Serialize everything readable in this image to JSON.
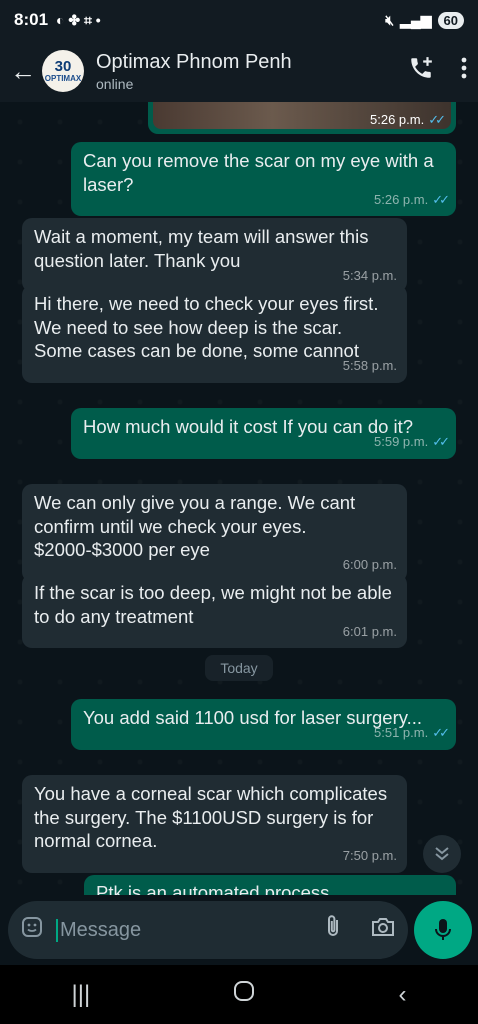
{
  "status_bar": {
    "time": "8:01",
    "battery": "60"
  },
  "header": {
    "chat_name": "Optimax Phnom Penh",
    "chat_status": "online"
  },
  "image_message": {
    "time": "5:26 p.m."
  },
  "messages": [
    {
      "direction": "out",
      "text": "Can you remove the scar on my eye with a laser?",
      "time": "5:26 p.m."
    },
    {
      "direction": "in",
      "text": "Wait a moment, my team will answer this question later. Thank you",
      "time": "5:34 p.m."
    },
    {
      "direction": "in",
      "text": "Hi there, we need to check your eyes first. We need to see how deep is the scar. Some cases can be done, some cannot",
      "time": "5:58 p.m."
    },
    {
      "direction": "out",
      "text": "How much would it cost If you can do it?",
      "time": "5:59 p.m."
    },
    {
      "direction": "in",
      "text": "We can only give you a range. We cant confirm until we check your eyes. $2000-$3000 per eye",
      "time": "6:00 p.m."
    },
    {
      "direction": "in",
      "text": "If the scar is too deep, we might not be able to do any treatment",
      "time": "6:01 p.m."
    },
    {
      "direction": "out",
      "text": "You add said 1100 usd for laser surgery...",
      "time": "5:51 p.m."
    },
    {
      "direction": "in",
      "text": "You have a corneal scar which complicates the surgery. The $1100USD surgery is for normal cornea.",
      "time": "7:50 p.m."
    },
    {
      "direction": "out",
      "text": "Ptk is an automated process"
    }
  ],
  "date_chip": "Today",
  "composer": {
    "placeholder": "Message"
  },
  "icons": {
    "back": "arrow-left-icon",
    "add_call": "phone-plus-icon",
    "menu": "more-vertical-icon",
    "emoji": "sticker-icon",
    "attach": "paperclip-icon",
    "camera": "camera-icon",
    "mic": "microphone-icon",
    "scroll": "double-chevron-down-icon"
  },
  "colors": {
    "outgoing": "#005c4b",
    "incoming": "#202c33",
    "accent": "#00a884",
    "read_ticks": "#53bdeb"
  }
}
